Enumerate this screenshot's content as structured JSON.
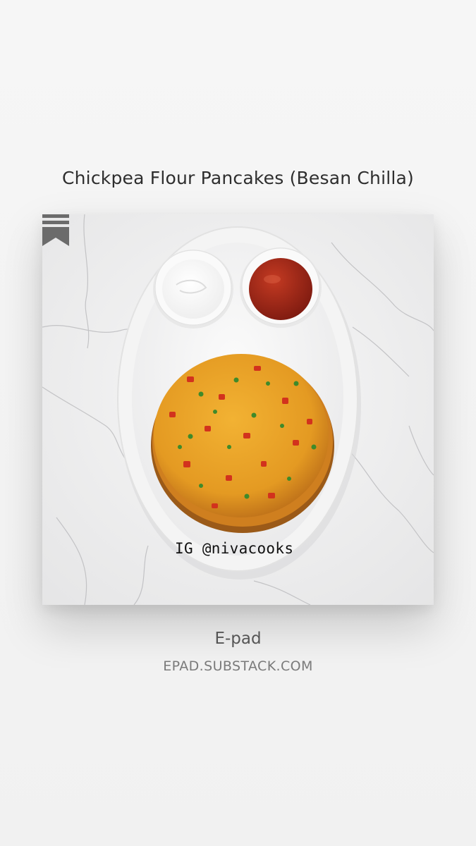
{
  "post": {
    "title": "Chickpea Flour Pancakes (Besan Chilla)",
    "image_watermark": "IG @nivacooks",
    "image_icon": "bookmark-icon"
  },
  "publication": {
    "name": "E-pad",
    "url": "EPAD.SUBSTACK.COM"
  },
  "colors": {
    "background": "#f4f4f4",
    "title_text": "#2e2e2e",
    "secondary_text": "#7a7a7a"
  }
}
